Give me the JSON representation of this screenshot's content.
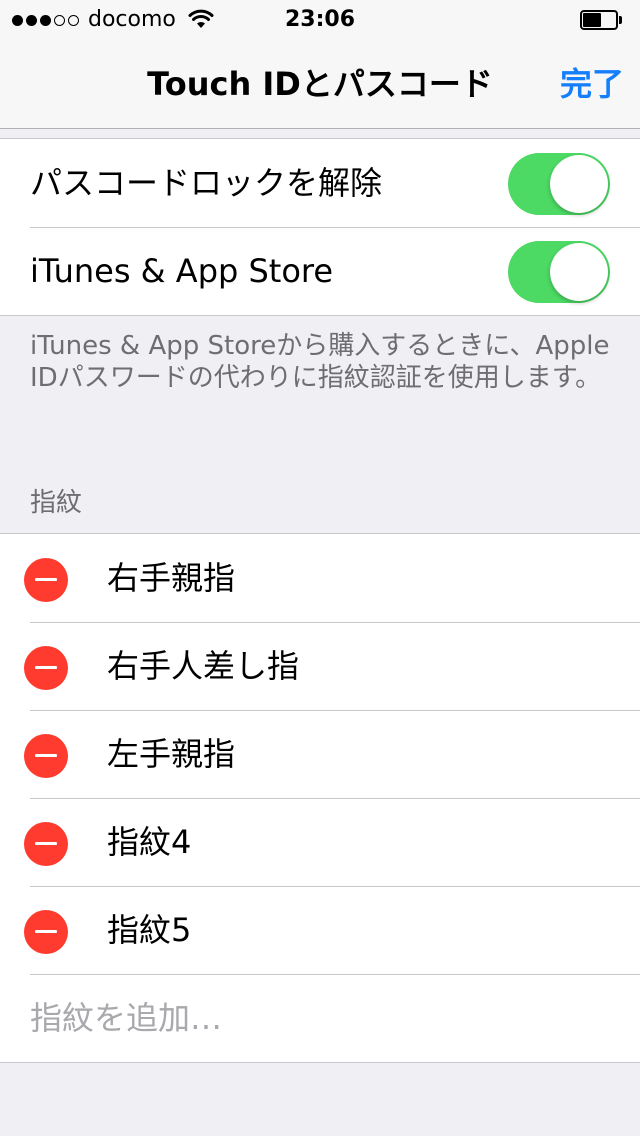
{
  "status_bar": {
    "signal_dots": {
      "filled": 3,
      "total": 5
    },
    "carrier": "docomo",
    "wifi_icon": "wifi-icon",
    "time": "23:06",
    "battery_level": 0.55
  },
  "nav": {
    "title": "Touch IDとパスコード",
    "done_label": "完了",
    "accent_color": "#147efb"
  },
  "settings": [
    {
      "label": "パスコードロックを解除",
      "on": true
    },
    {
      "label": "iTunes & App Store",
      "on": true
    }
  ],
  "toggle_on_color": "#4cd964",
  "footer_note": "iTunes & App Storeから購入するときに、Apple IDパスワードの代わりに指紋認証を使用します。",
  "fingerprints": {
    "header": "指紋",
    "items": [
      "右手親指",
      "右手人差し指",
      "左手親指",
      "指紋4",
      "指紋5"
    ],
    "delete_color": "#ff3b30",
    "add_label": "指紋を追加…"
  }
}
